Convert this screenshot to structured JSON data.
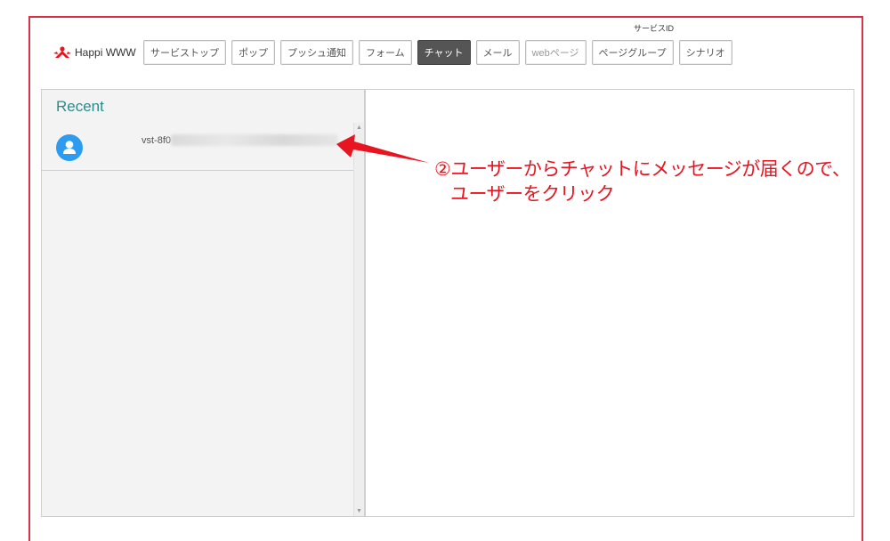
{
  "header": {
    "service_id_label": "サービスID",
    "logo_text": "Happi WWW"
  },
  "nav": {
    "items": [
      {
        "label": "サービストップ",
        "state": "normal"
      },
      {
        "label": "ポップ",
        "state": "normal"
      },
      {
        "label": "プッシュ通知",
        "state": "normal"
      },
      {
        "label": "フォーム",
        "state": "normal"
      },
      {
        "label": "チャット",
        "state": "active"
      },
      {
        "label": "メール",
        "state": "normal"
      },
      {
        "label": "webページ",
        "state": "muted"
      },
      {
        "label": "ページグループ",
        "state": "normal"
      },
      {
        "label": "シナリオ",
        "state": "normal"
      }
    ]
  },
  "sidebar": {
    "title": "Recent",
    "items": [
      {
        "user_id": "vst-8f0"
      }
    ]
  },
  "annotation": {
    "line1": "②ユーザーからチャットにメッセージが届くので、",
    "line2": "ユーザーをクリック"
  },
  "colors": {
    "frame": "#d9334a",
    "accent_teal": "#2e8a8a",
    "avatar": "#2d9cf0",
    "annotation_red": "#e8141f",
    "active_tab": "#555555"
  }
}
